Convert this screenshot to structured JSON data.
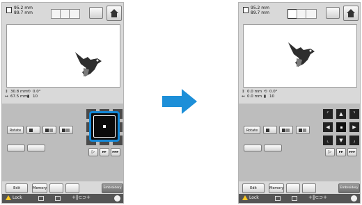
{
  "left_screen": {
    "size_w": "95.2 mm",
    "size_h": "89.7 mm",
    "offset_x": "30.8 mm",
    "offset_y": "67.5 mm",
    "angle": "0.0°",
    "stitch_count": "10",
    "rotate_label": "Rotate",
    "edit_label": "Edit",
    "memory_label": "Memory",
    "embroidery_label": "Embroidery",
    "lock_label": "Lock"
  },
  "right_screen": {
    "size_w": "95.2 mm",
    "size_h": "89.7 mm",
    "offset_x": "0.0 mm",
    "offset_y": "0.0 mm",
    "angle": "0.0°",
    "stitch_count": "10",
    "rotate_label": "Rotate",
    "edit_label": "Edit",
    "memory_label": "Memory",
    "embroidery_label": "Embroidery",
    "lock_label": "Lock"
  },
  "icons": {
    "arrow": "right-arrow-icon",
    "dpad_up": "▲",
    "dpad_down": "▼",
    "dpad_left": "◀",
    "dpad_right": "▶"
  },
  "colors": {
    "highlight": "#1388d8",
    "arrow": "#1d8fd8",
    "warning": "#ffc820"
  }
}
